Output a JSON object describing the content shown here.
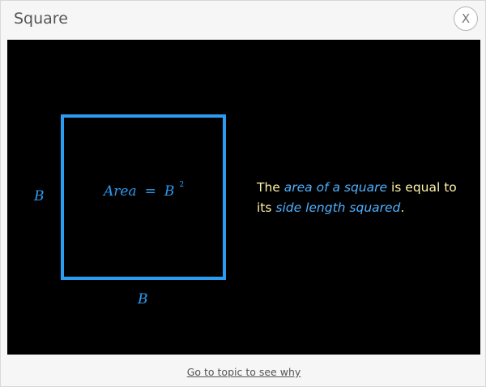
{
  "dialog": {
    "title": "Square",
    "close_label": "X"
  },
  "figure": {
    "side_left_label": "B",
    "side_bottom_label": "B",
    "formula": {
      "lhs": "Area",
      "eq": "=",
      "var": "B",
      "exponent": "2"
    },
    "explanation": {
      "part1": "The ",
      "highlight1": "area of a square",
      "part2": " is equal to its ",
      "highlight2": "side length squared",
      "part3": "."
    }
  },
  "footer": {
    "link_text": "Go to topic to see why"
  },
  "colors": {
    "accent": "#2d9bf0",
    "text_highlight": "#4fb0ff",
    "text_yellow": "#fff3a8",
    "canvas_bg": "#000000"
  }
}
